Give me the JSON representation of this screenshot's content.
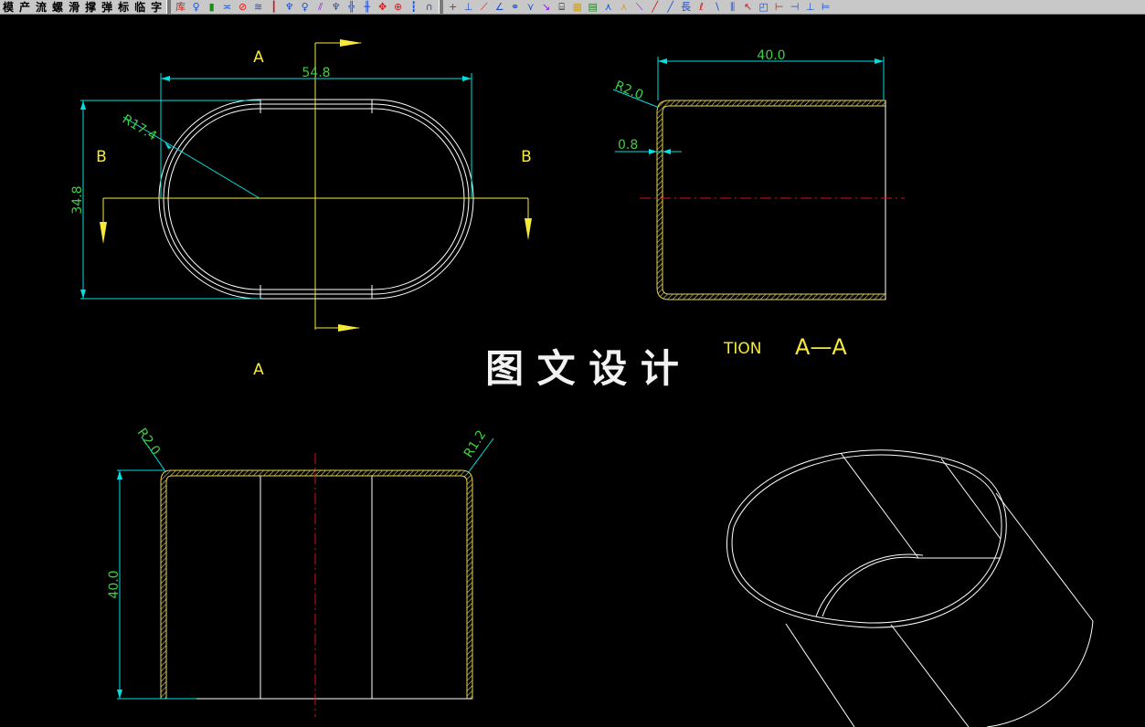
{
  "toolbar": {
    "menu_items": [
      "模",
      "产",
      "流",
      "螺",
      "滑",
      "撑",
      "弹",
      "标",
      "临",
      "字"
    ],
    "tool_icons": [
      {
        "name": "library-icon",
        "glyph": "库",
        "color": "#d11a1a"
      },
      {
        "name": "pin-icon",
        "glyph": "♀",
        "color": "#1a4fd1"
      },
      {
        "name": "bolt-icon",
        "glyph": "▮",
        "color": "#1a8a1a"
      },
      {
        "name": "spring-icon",
        "glyph": "≍",
        "color": "#1a4fd1"
      },
      {
        "name": "target-icon",
        "glyph": "⊘",
        "color": "#d11a1a"
      },
      {
        "name": "coil-icon",
        "glyph": "≋",
        "color": "#1a4fd1"
      },
      {
        "name": "ejector-icon",
        "glyph": "┃",
        "color": "#d11a1a"
      },
      {
        "name": "sprue-icon",
        "glyph": "♆",
        "color": "#1a4fd1"
      },
      {
        "name": "nozzle-icon",
        "glyph": "♀",
        "color": "#1a4fd1"
      },
      {
        "name": "slant-icon",
        "glyph": "⫽",
        "color": "#8a1ad1"
      },
      {
        "name": "valve-icon",
        "glyph": "♆",
        "color": "#1a4fd1"
      },
      {
        "name": "gate-icon",
        "glyph": "╬",
        "color": "#1a4fd1"
      },
      {
        "name": "runner-icon",
        "glyph": "╫",
        "color": "#1a4fd1"
      },
      {
        "name": "insert-icon",
        "glyph": "✥",
        "color": "#d11a1a"
      },
      {
        "name": "crosshair-icon",
        "glyph": "⊕",
        "color": "#d11a1a"
      },
      {
        "name": "rod-icon",
        "glyph": "┇",
        "color": "#1a4fd1"
      },
      {
        "name": "arch-icon",
        "glyph": "∩",
        "color": "#1a4fd1"
      }
    ],
    "dim_icons": [
      {
        "name": "point-icon",
        "glyph": "+",
        "color": "#d11a1a"
      },
      {
        "name": "perpendicular-icon",
        "glyph": "⊥",
        "color": "#1a4fd1"
      },
      {
        "name": "angle-line-icon",
        "glyph": "⟋",
        "color": "#d11a1a"
      },
      {
        "name": "dim-angle-icon",
        "glyph": "∠",
        "color": "#1a4fd1"
      },
      {
        "name": "node-icon",
        "glyph": "⚭",
        "color": "#1a4fd1"
      },
      {
        "name": "fork-icon",
        "glyph": "⋎",
        "color": "#1a4fd1"
      },
      {
        "name": "leader-icon",
        "glyph": "↘",
        "color": "#8a1ad1"
      },
      {
        "name": "text-block-icon",
        "glyph": "⌸",
        "color": "#000000"
      },
      {
        "name": "hatch-icon",
        "glyph": "▦",
        "color": "#d1a01a"
      },
      {
        "name": "layer-icon",
        "glyph": "▤",
        "color": "#1a8a1a"
      },
      {
        "name": "branch-icon",
        "glyph": "⋏",
        "color": "#1a4fd1"
      },
      {
        "name": "split-icon",
        "glyph": "⋏",
        "color": "#d1a01a"
      },
      {
        "name": "diagonal-icon",
        "glyph": "⟍",
        "color": "#8a1ad1"
      },
      {
        "name": "line-icon",
        "glyph": "╱",
        "color": "#d11a1a"
      },
      {
        "name": "slash-icon",
        "glyph": "╱",
        "color": "#1a4fd1"
      },
      {
        "name": "length-icon",
        "glyph": "長",
        "color": "#1a4fd1"
      },
      {
        "name": "probe-icon",
        "glyph": "ℓ",
        "color": "#d11a1a"
      },
      {
        "name": "arc-icon",
        "glyph": "∖",
        "color": "#1a4fd1"
      },
      {
        "name": "chart-icon",
        "glyph": "⫼",
        "color": "#1a4fd1"
      },
      {
        "name": "pointer-icon",
        "glyph": "↖",
        "color": "#d11a1a"
      },
      {
        "name": "box-icon",
        "glyph": "◰",
        "color": "#1a4fd1"
      },
      {
        "name": "align-icon",
        "glyph": "⊢",
        "color": "#d11a1a"
      },
      {
        "name": "dash-icon",
        "glyph": "⊣",
        "color": "#1a4fd1"
      },
      {
        "name": "vertical-icon",
        "glyph": "⊥",
        "color": "#1a4fd1"
      },
      {
        "name": "bracket-icon",
        "glyph": "⊨",
        "color": "#1a4fd1"
      }
    ]
  },
  "drawing": {
    "top_view": {
      "section_label_top": "A",
      "section_label_bottom": "A",
      "section_label_left": "B",
      "section_label_right": "B",
      "dim_width": "54.8",
      "dim_height": "34.8",
      "dim_radius": "R17.4"
    },
    "side_section": {
      "dim_length": "40.0",
      "dim_radius": "R2.0",
      "dim_thickness": "0.8",
      "title_prefix": "TION",
      "title_main": "A—A"
    },
    "front_section": {
      "dim_radius_left": "R2.0",
      "dim_radius_right": "R1.2",
      "dim_height": "40.0"
    },
    "watermark": "图 文 设 计"
  },
  "colors": {
    "background": "#000000",
    "geometry": "#ffffff",
    "dimension": "#3fcf3f",
    "dimension_line": "#00e0e0",
    "section_line": "#f7e93b",
    "center_line": "#e01010",
    "hatch": "#e6d35a",
    "toolbar": "#c8c8c8"
  }
}
